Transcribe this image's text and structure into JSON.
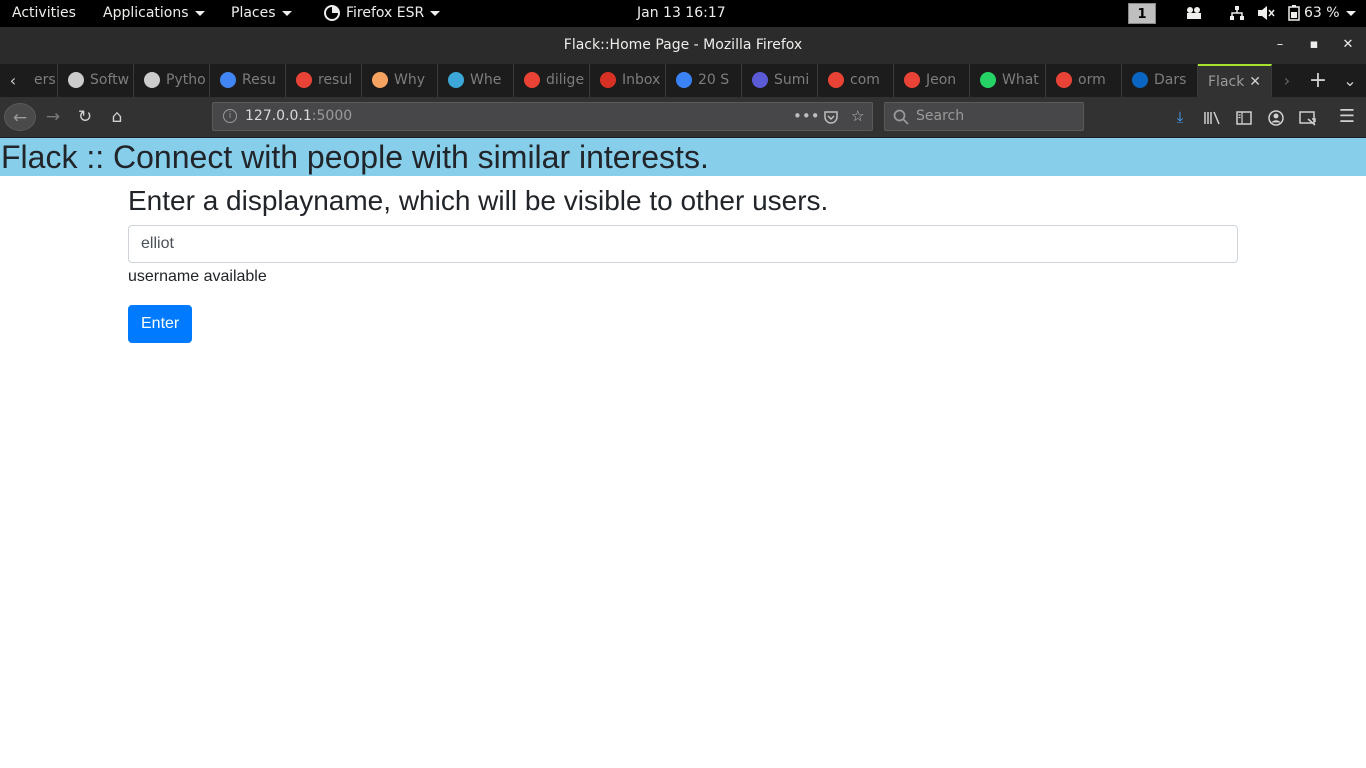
{
  "system_bar": {
    "activities": "Activities",
    "applications": "Applications",
    "places": "Places",
    "firefox_menu": "Firefox ESR",
    "clock": "Jan 13  16:17",
    "workspace": "1",
    "battery_percent": "63 %"
  },
  "window": {
    "title": "Flack::Home Page - Mozilla Firefox",
    "minimize": "–",
    "maximize": "▪",
    "close": "✕"
  },
  "tabs": [
    {
      "label": "ers",
      "icon": "generic-icon",
      "color": "#555555"
    },
    {
      "label": "Softw",
      "icon": "peace-icon",
      "color": "#cccccc"
    },
    {
      "label": "Pytho",
      "icon": "peace-icon",
      "color": "#cccccc"
    },
    {
      "label": "Resu",
      "icon": "docs-icon",
      "color": "#4285f4"
    },
    {
      "label": "resul",
      "icon": "google-icon",
      "color": "#ea4335"
    },
    {
      "label": "Why",
      "icon": "hand-icon",
      "color": "#f4a460"
    },
    {
      "label": "Whe",
      "icon": "m-icon",
      "color": "#3da8d8"
    },
    {
      "label": "dilige",
      "icon": "google-icon",
      "color": "#ea4335"
    },
    {
      "label": "Inbox",
      "icon": "gmail-icon",
      "color": "#d93025"
    },
    {
      "label": "20 S",
      "icon": "bookmark-icon",
      "color": "#3b82f6"
    },
    {
      "label": "Sumi",
      "icon": "bookmark-icon",
      "color": "#5b5bd6"
    },
    {
      "label": "com",
      "icon": "google-icon",
      "color": "#ea4335"
    },
    {
      "label": "Jeon",
      "icon": "google-icon",
      "color": "#ea4335"
    },
    {
      "label": "What",
      "icon": "whatsapp-icon",
      "color": "#25d366"
    },
    {
      "label": "orm",
      "icon": "google-icon",
      "color": "#ea4335"
    },
    {
      "label": "Dars",
      "icon": "linkedin-icon",
      "color": "#0a66c2"
    }
  ],
  "active_tab": {
    "label": "Flack",
    "close": "✕"
  },
  "navbar": {
    "url_host": "127.0.0.1",
    "url_port": ":5000",
    "search_placeholder": "Search"
  },
  "page": {
    "banner_title": "Flack :: Connect with people with similar interests.",
    "prompt": "Enter a displayname, which will be visible to other users.",
    "name_value": "elliot",
    "status": "username available",
    "enter_label": "Enter"
  },
  "colors": {
    "banner": "#87ceeb",
    "primary_button": "#007bff"
  }
}
